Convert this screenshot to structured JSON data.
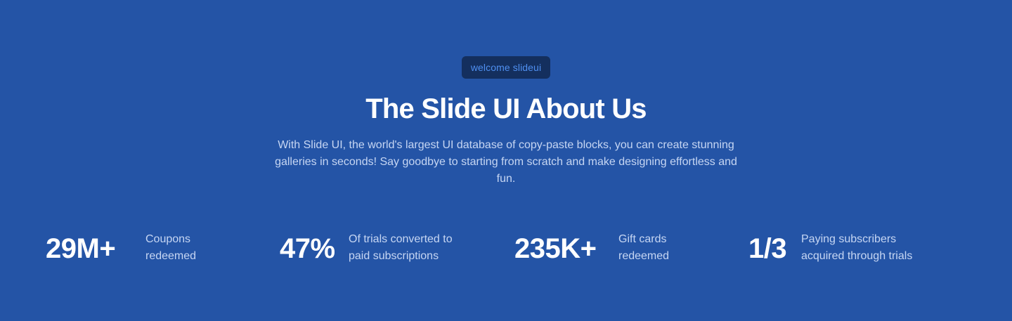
{
  "hero": {
    "badge": "welcome slideui",
    "title": "The Slide UI About Us",
    "description": "With Slide UI, the world's largest UI database of copy-paste blocks, you can create stunning galleries in seconds! Say goodbye to starting from scratch and make designing effortless and fun."
  },
  "stats": [
    {
      "value": "29M+",
      "label": "Coupons\nredeemed"
    },
    {
      "value": "47%",
      "label": "Of trials converted to\npaid subscriptions"
    },
    {
      "value": "235K+",
      "label": "Gift cards\nredeemed"
    },
    {
      "value": "1/3",
      "label": "Paying subscribers\nacquired through trials"
    }
  ],
  "colors": {
    "background": "#2454a6",
    "badge_bg": "#142f5e",
    "badge_text": "#4f8ff0",
    "heading": "#ffffff",
    "body_text": "#c6d6f3"
  }
}
